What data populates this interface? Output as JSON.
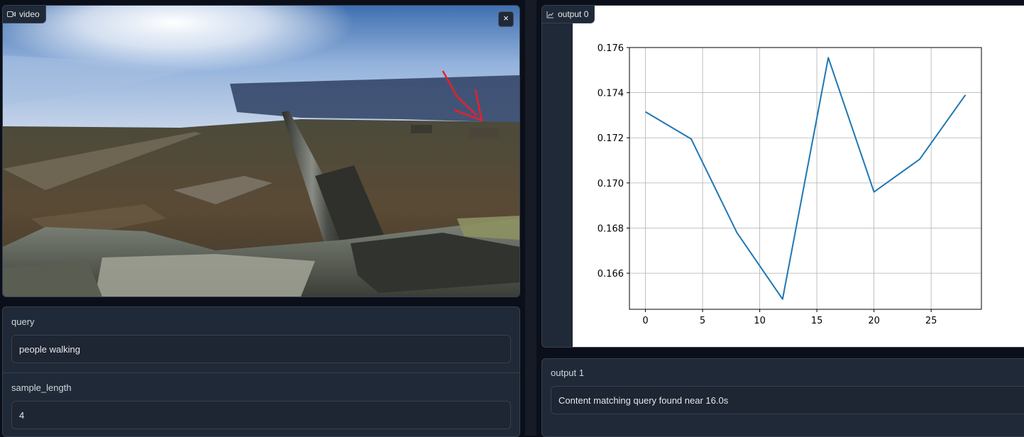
{
  "video": {
    "label": "video",
    "close_symbol": "×"
  },
  "inputs": {
    "query": {
      "label": "query",
      "value": "people walking"
    },
    "sample_length": {
      "label": "sample_length",
      "value": "4"
    }
  },
  "output0": {
    "label": "output 0"
  },
  "output1": {
    "label": "output 1",
    "value": "Content matching query found near 16.0s"
  },
  "colors": {
    "line": "#1f77b4",
    "panel": "#1f2937",
    "border": "#374151",
    "annotation": "#e8202a"
  },
  "chart_data": {
    "type": "line",
    "title": "",
    "xlabel": "",
    "ylabel": "",
    "x": [
      0,
      4,
      8,
      12,
      16,
      20,
      24,
      28
    ],
    "series": [
      {
        "values": [
          0.17315,
          0.17195,
          0.1678,
          0.16485,
          0.17555,
          0.1696,
          0.17105,
          0.1739
        ]
      }
    ],
    "xlim": [
      -1.4,
      29.4
    ],
    "ylim": [
      0.1644,
      0.176
    ],
    "xticks": [
      0,
      5,
      10,
      15,
      20,
      25
    ],
    "xtick_labels": [
      "0",
      "5",
      "10",
      "15",
      "20",
      "25"
    ],
    "yticks": [
      0.166,
      0.168,
      0.17,
      0.172,
      0.174,
      0.176
    ],
    "ytick_labels": [
      "0.166",
      "0.168",
      "0.170",
      "0.172",
      "0.174",
      "0.176"
    ],
    "grid": true
  }
}
